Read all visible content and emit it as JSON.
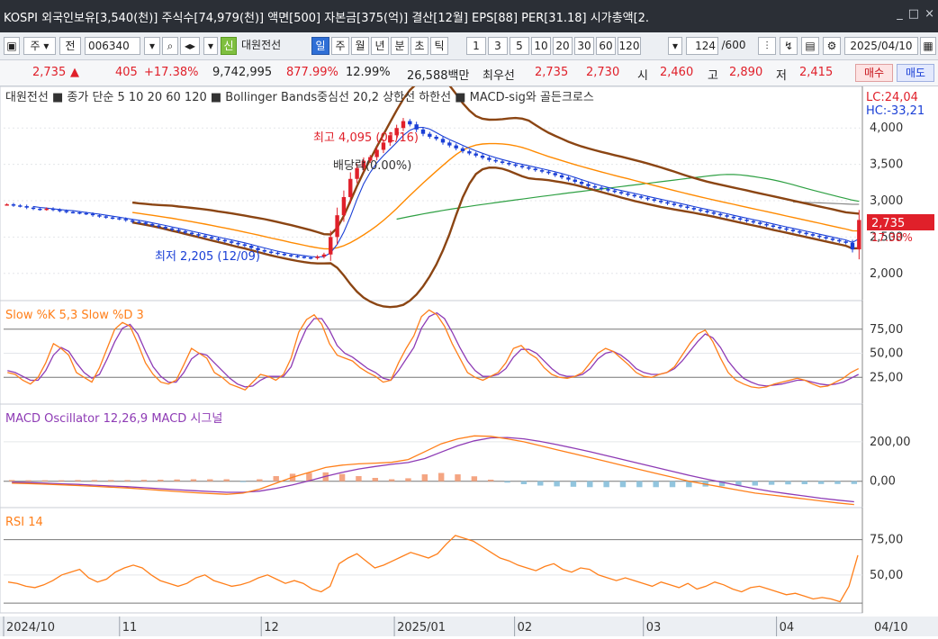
{
  "infobar": {
    "text": "KOSPI 외국인보유[3,540(천)] 주식수[74,979(천)] 액면[500] 자본금[375(억)] 결산[12월] EPS[88] PER[31.18] 시가총액[2.",
    "window_buttons": [
      "_",
      "□",
      "×"
    ]
  },
  "toolbar": {
    "period_type": "주",
    "all_label": "전",
    "code": "006340",
    "stock_name": "대원전선",
    "credit_badge": "신",
    "period_tabs": [
      "일",
      "주",
      "월",
      "년",
      "분",
      "초",
      "틱"
    ],
    "active_tab": "일",
    "interval_buttons": [
      "1",
      "3",
      "5",
      "10",
      "20",
      "30",
      "60",
      "120"
    ],
    "count_value": "124",
    "count_total": "/600",
    "date": "2025/04/10"
  },
  "quote": {
    "price": "2,735",
    "change": "405",
    "change_pct": "+17.38%",
    "volume": "9,742,995",
    "volume_pct": "877.99%",
    "turnover_pct": "12.99%",
    "trade_amount": "26,588백만",
    "best_bid_label": "최우선",
    "best_ask": "2,735",
    "best_bid": "2,730",
    "open_label": "시",
    "open": "2,460",
    "high_label": "고",
    "high": "2,890",
    "low_label": "저",
    "low": "2,415",
    "buy_label": "매수",
    "sell_label": "매도"
  },
  "legend": {
    "price_panel": "대원전선 ■ 종가 단순 5  10  20  60  120 ■ Bollinger Bands중심선 20,2  상한선  하한선 ■ MACD-sig와 골든크로스",
    "lc": "LC:24,04",
    "hc": "HC:-33,21",
    "stoch": "Slow %K 5,3  Slow %D 3",
    "macd": "MACD Oscillator 12,26,9  MACD  시그널",
    "rsi": "RSI 14"
  },
  "annotations": {
    "high": "최고 4,095 (01/16)",
    "low": "최저 2,205 (12/09)",
    "dividend": "배당락(0.00%)",
    "last_price": "2,735",
    "last_change": "17.38%"
  },
  "colors": {
    "up": "#e0202a",
    "down": "#1a3fd6",
    "bollinger": "#8b4513",
    "ma5": "#1a3fd6",
    "ma20": "#ff8a00",
    "ma60": "#2ea043",
    "ma120": "#8a8a8a",
    "stoch_k": "#ff7f1a",
    "stoch_d": "#8e3bb5",
    "macd_line": "#ff7f1a",
    "macd_signal": "#8e3bb5",
    "rsi": "#ff7f1a"
  },
  "chart_data": [
    {
      "type": "candlestick",
      "title": "대원전선",
      "yticks": [
        2000,
        2500,
        3000,
        3500,
        4000
      ],
      "ylim": [
        1700,
        4300
      ],
      "x_labels": [
        "2024/10",
        "11",
        "12",
        "2025/01",
        "02",
        "03",
        "04",
        "04/10"
      ],
      "close": [
        2950,
        2935,
        2925,
        2905,
        2890,
        2880,
        2890,
        2875,
        2860,
        2845,
        2840,
        2830,
        2820,
        2800,
        2785,
        2770,
        2760,
        2750,
        2730,
        2710,
        2700,
        2680,
        2660,
        2640,
        2620,
        2600,
        2580,
        2560,
        2540,
        2520,
        2500,
        2480,
        2460,
        2440,
        2420,
        2400,
        2380,
        2350,
        2320,
        2300,
        2285,
        2270,
        2255,
        2240,
        2230,
        2220,
        2210,
        2230,
        2260,
        2500,
        2800,
        3050,
        3300,
        3450,
        3550,
        3600,
        3700,
        3800,
        3900,
        4000,
        4095,
        4050,
        3980,
        3920,
        3880,
        3850,
        3800,
        3760,
        3720,
        3680,
        3650,
        3620,
        3590,
        3560,
        3540,
        3520,
        3500,
        3480,
        3460,
        3440,
        3420,
        3400,
        3380,
        3350,
        3320,
        3290,
        3260,
        3230,
        3200,
        3180,
        3160,
        3140,
        3120,
        3100,
        3080,
        3060,
        3040,
        3020,
        3000,
        2980,
        2960,
        2940,
        2920,
        2900,
        2880,
        2860,
        2840,
        2820,
        2800,
        2780,
        2760,
        2740,
        2720,
        2700,
        2680,
        2660,
        2640,
        2620,
        2600,
        2580,
        2560,
        2540,
        2520,
        2500,
        2480,
        2460,
        2440,
        2420,
        2330,
        2735
      ]
    },
    {
      "type": "line",
      "title": "Slow %K 5,3  Slow %D 3",
      "yticks": [
        25,
        50,
        75
      ],
      "ylim": [
        0,
        100
      ],
      "k": [
        30,
        28,
        22,
        18,
        25,
        40,
        60,
        55,
        48,
        30,
        25,
        20,
        35,
        55,
        75,
        82,
        78,
        60,
        40,
        28,
        20,
        18,
        22,
        38,
        55,
        50,
        45,
        30,
        25,
        18,
        15,
        12,
        20,
        28,
        26,
        22,
        28,
        45,
        72,
        85,
        90,
        80,
        60,
        48,
        45,
        42,
        35,
        30,
        26,
        20,
        22,
        40,
        55,
        68,
        88,
        95,
        90,
        78,
        60,
        45,
        30,
        25,
        22,
        26,
        30,
        40,
        55,
        58,
        50,
        45,
        35,
        28,
        25,
        24,
        26,
        30,
        40,
        50,
        55,
        52,
        45,
        38,
        30,
        26,
        25,
        28,
        30,
        36,
        48,
        60,
        70,
        74,
        62,
        45,
        30,
        22,
        18,
        15,
        14,
        15,
        18,
        20,
        22,
        24,
        22,
        18,
        15,
        16,
        20,
        24,
        30,
        34
      ],
      "d": [
        32,
        30,
        26,
        22,
        22,
        32,
        48,
        56,
        52,
        40,
        30,
        24,
        28,
        44,
        62,
        76,
        80,
        70,
        52,
        36,
        26,
        20,
        20,
        30,
        44,
        50,
        48,
        40,
        32,
        24,
        18,
        15,
        16,
        22,
        26,
        26,
        26,
        36,
        58,
        76,
        86,
        86,
        74,
        58,
        50,
        46,
        40,
        34,
        30,
        24,
        22,
        32,
        44,
        56,
        76,
        88,
        92,
        86,
        72,
        56,
        42,
        32,
        26,
        26,
        28,
        34,
        46,
        54,
        54,
        50,
        42,
        34,
        28,
        26,
        26,
        28,
        34,
        44,
        50,
        52,
        48,
        42,
        34,
        30,
        28,
        28,
        30,
        34,
        42,
        52,
        62,
        70,
        66,
        56,
        42,
        32,
        24,
        20,
        17,
        16,
        17,
        18,
        20,
        22,
        22,
        20,
        18,
        17,
        18,
        20,
        24,
        28
      ]
    },
    {
      "type": "line",
      "title": "MACD Oscillator 12,26,9  MACD  시그널",
      "yticks": [
        0,
        200
      ],
      "ylim": [
        -120,
        300
      ],
      "macd": [
        -10,
        -12,
        -15,
        -18,
        -22,
        -26,
        -30,
        -34,
        -40,
        -46,
        -52,
        -58,
        -62,
        -66,
        -60,
        -40,
        -10,
        20,
        45,
        70,
        82,
        88,
        92,
        96,
        110,
        150,
        190,
        215,
        230,
        228,
        215,
        200,
        180,
        160,
        140,
        120,
        100,
        80,
        60,
        40,
        20,
        0,
        -15,
        -30,
        -45,
        -60,
        -70,
        -80,
        -90,
        -100,
        -110,
        -118
      ],
      "signal": [
        -5,
        -7,
        -10,
        -13,
        -16,
        -20,
        -24,
        -28,
        -33,
        -38,
        -43,
        -48,
        -52,
        -56,
        -56,
        -50,
        -36,
        -18,
        2,
        25,
        45,
        62,
        75,
        86,
        95,
        115,
        148,
        180,
        205,
        220,
        222,
        215,
        202,
        186,
        168,
        150,
        130,
        110,
        90,
        70,
        50,
        30,
        12,
        -5,
        -22,
        -38,
        -52,
        -64,
        -75,
        -86,
        -96,
        -104
      ],
      "oscillator": [
        6,
        5,
        5,
        5,
        6,
        6,
        6,
        6,
        7,
        8,
        9,
        10,
        10,
        10,
        -4,
        10,
        26,
        38,
        43,
        45,
        37,
        26,
        17,
        10,
        15,
        35,
        42,
        35,
        25,
        8,
        -7,
        -15,
        -22,
        -26,
        -28,
        -30,
        -30,
        -30,
        -30,
        -30,
        -30,
        -30,
        -27,
        -25,
        -23,
        -22,
        -18,
        -16,
        -15,
        -14,
        -14,
        -14
      ]
    },
    {
      "type": "line",
      "title": "RSI 14",
      "yticks": [
        50,
        75
      ],
      "ylim": [
        25,
        85
      ],
      "values": [
        45,
        44,
        42,
        41,
        43,
        46,
        50,
        52,
        54,
        48,
        45,
        47,
        52,
        55,
        57,
        55,
        50,
        46,
        44,
        42,
        44,
        48,
        50,
        46,
        44,
        42,
        43,
        45,
        48,
        50,
        47,
        44,
        46,
        44,
        40,
        38,
        42,
        58,
        62,
        65,
        60,
        55,
        57,
        60,
        63,
        66,
        64,
        62,
        65,
        72,
        78,
        76,
        74,
        70,
        66,
        62,
        60,
        57,
        55,
        53,
        56,
        58,
        54,
        52,
        55,
        54,
        50,
        48,
        46,
        48,
        46,
        44,
        42,
        45,
        43,
        41,
        44,
        40,
        42,
        45,
        43,
        40,
        38,
        41,
        42,
        40,
        38,
        36,
        37,
        35,
        33,
        34,
        33,
        31,
        42,
        64
      ]
    }
  ]
}
